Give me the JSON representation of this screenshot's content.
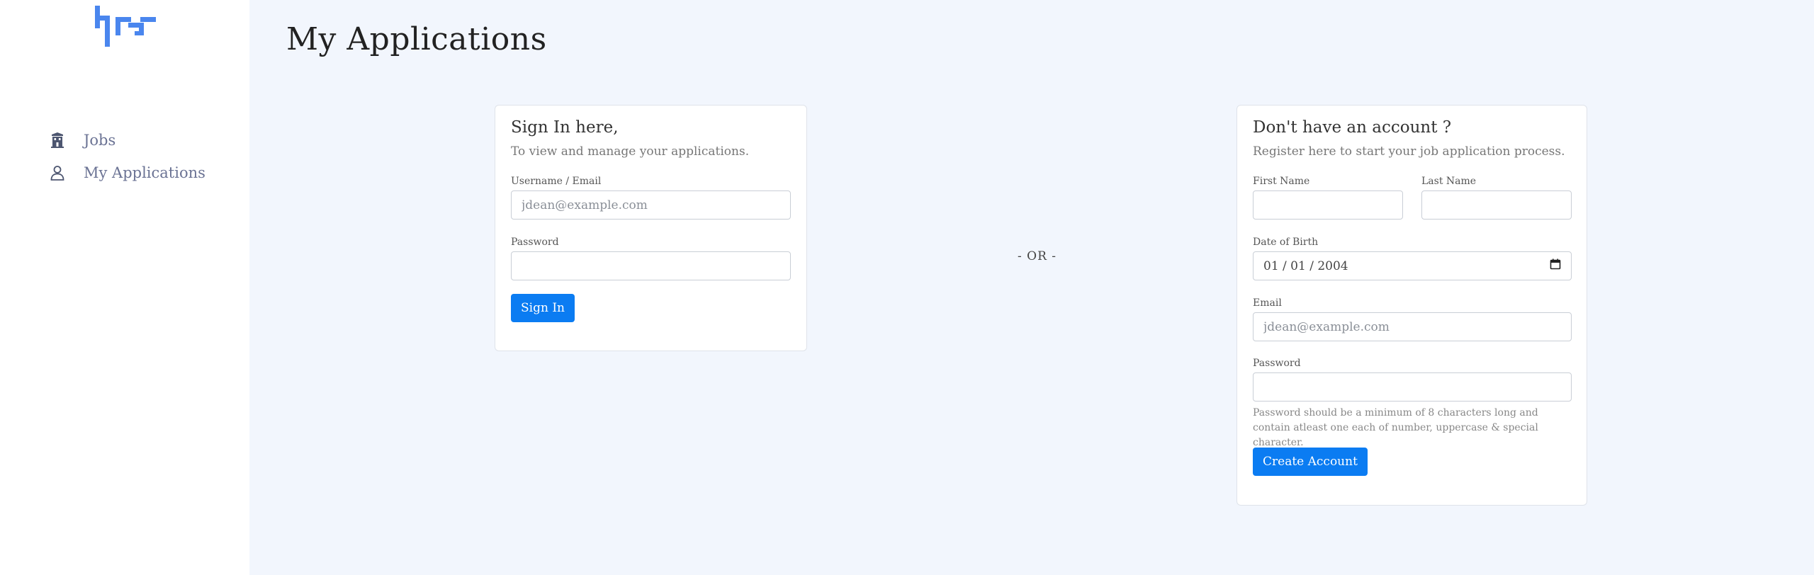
{
  "sidebar": {
    "logo_text": "hrs",
    "items": [
      {
        "label": "Jobs",
        "icon": "building-icon"
      },
      {
        "label": "My Applications",
        "icon": "user-icon"
      }
    ]
  },
  "main": {
    "title": "My Applications",
    "divider": "- OR -"
  },
  "signin": {
    "title": "Sign In here,",
    "subtitle": "To view and manage your applications.",
    "username_label": "Username / Email",
    "username_placeholder": "jdean@example.com",
    "password_label": "Password",
    "button": "Sign In"
  },
  "register": {
    "title": "Don't have an account ?",
    "subtitle": "Register here to start your job application process.",
    "first_name_label": "First Name",
    "last_name_label": "Last Name",
    "dob_label": "Date of Birth",
    "dob_value": "01 / 01 / 2004",
    "email_label": "Email",
    "email_placeholder": "jdean@example.com",
    "password_label": "Password",
    "password_help": "Password should be a minimum of 8 characters long and contain atleast one each of number, uppercase & special character.",
    "button": "Create Account"
  },
  "colors": {
    "accent": "#0b7cf2",
    "logo": "#4a86ee",
    "background": "#f2f6fd"
  }
}
